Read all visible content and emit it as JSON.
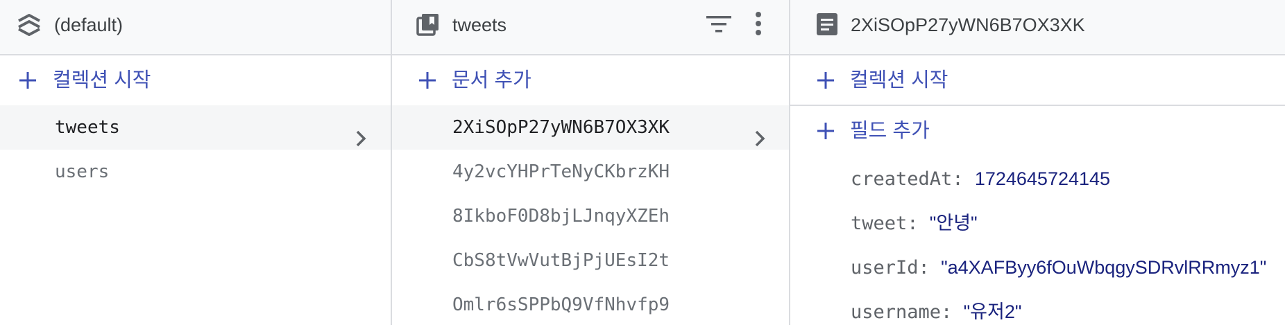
{
  "col1": {
    "header_title": "(default)",
    "header_icon": "database-stack-icon",
    "add_label": "컬렉션 시작",
    "items": [
      {
        "label": "tweets",
        "selected": true
      },
      {
        "label": "users",
        "selected": false
      }
    ]
  },
  "col2": {
    "header_title": "tweets",
    "header_icon": "collection-icon",
    "add_label": "문서 추가",
    "items": [
      {
        "label": "2XiSOpP27yWN6B7OX3XK",
        "selected": true
      },
      {
        "label": "4y2vcYHPrTeNyCKbrzKH",
        "selected": false
      },
      {
        "label": "8IkboF0D8bjLJnqyXZEh",
        "selected": false
      },
      {
        "label": "CbS8tVwVutBjPjUEsI2t",
        "selected": false
      },
      {
        "label": "Omlr6sSPPbQ9VfNhvfp9",
        "selected": false
      }
    ]
  },
  "col3": {
    "header_title": "2XiSOpP27yWN6B7OX3XK",
    "header_icon": "document-icon",
    "add_collection_label": "컬렉션 시작",
    "add_field_label": "필드 추가",
    "fields": [
      {
        "key": "createdAt",
        "value": "1724645724145"
      },
      {
        "key": "tweet",
        "value": "\"안녕\""
      },
      {
        "key": "userId",
        "value": "\"a4XAFByy6fOuWbqgySDRvlRRmyz1\""
      },
      {
        "key": "username",
        "value": "\"유저2\""
      }
    ]
  },
  "colors": {
    "accent": "#3f51b5",
    "header_bg": "#f8f9fa",
    "divider": "#dadce0",
    "selected_bg": "#f5f6f7",
    "value_text": "#1a237e"
  }
}
